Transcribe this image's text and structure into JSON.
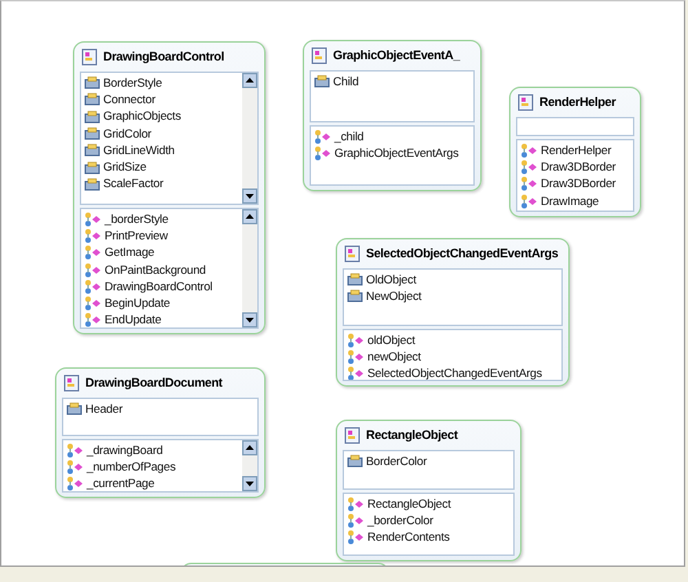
{
  "diagram": {
    "classes": [
      {
        "name": "DrawingBoardControl",
        "properties": {
          "scrollbar": true,
          "members": [
            "BorderStyle",
            "Connector",
            "GraphicObjects",
            "GridColor",
            "GridLineWidth",
            "GridSize",
            "ScaleFactor"
          ]
        },
        "methods": {
          "scrollbar": true,
          "members": [
            "_borderStyle",
            "PrintPreview",
            "GetImage",
            "OnPaintBackground",
            "DrawingBoardControl",
            "BeginUpdate",
            "EndUpdate"
          ]
        }
      },
      {
        "name": "GraphicObjectEventA_",
        "properties": {
          "members": [
            "Child"
          ]
        },
        "methods": {
          "members": [
            "_child",
            "GraphicObjectEventArgs"
          ]
        }
      },
      {
        "name": "RenderHelper",
        "methods": {
          "members": [
            "RenderHelper",
            "Draw3DBorder",
            "Draw3DBorder",
            "DrawImage"
          ]
        }
      },
      {
        "name": "SelectedObjectChangedEventArgs",
        "properties": {
          "members": [
            "OldObject",
            "NewObject"
          ]
        },
        "methods": {
          "members": [
            "oldObject",
            "newObject",
            "SelectedObjectChangedEventArgs"
          ]
        }
      },
      {
        "name": "DrawingBoardDocument",
        "properties": {
          "members": [
            "Header"
          ]
        },
        "methods": {
          "scrollbar": true,
          "members": [
            "_drawingBoard",
            "_numberOfPages",
            "_currentPage"
          ]
        }
      },
      {
        "name": "RectangleObject",
        "properties": {
          "members": [
            "BorderColor"
          ]
        },
        "methods": {
          "members": [
            "RectangleObject",
            "_borderColor",
            "RenderContents"
          ]
        }
      }
    ]
  }
}
